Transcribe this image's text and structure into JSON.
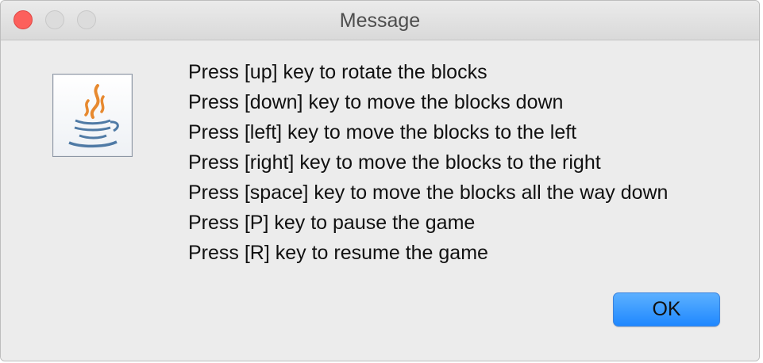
{
  "window": {
    "title": "Message"
  },
  "icon": {
    "name": "java-cup-icon"
  },
  "messages": [
    "Press [up] key to rotate the blocks",
    "Press [down] key to move the blocks down",
    "Press [left] key to move the blocks to the left",
    "Press [right] key to move the blocks to the right",
    "Press [space] key to move the blocks all the way down",
    "Press [P] key to pause the game",
    "Press [R] key to resume the game"
  ],
  "buttons": {
    "ok_label": "OK"
  },
  "colors": {
    "close": "#fc605c",
    "button_accent": "#1f88ff",
    "background": "#ececec"
  }
}
